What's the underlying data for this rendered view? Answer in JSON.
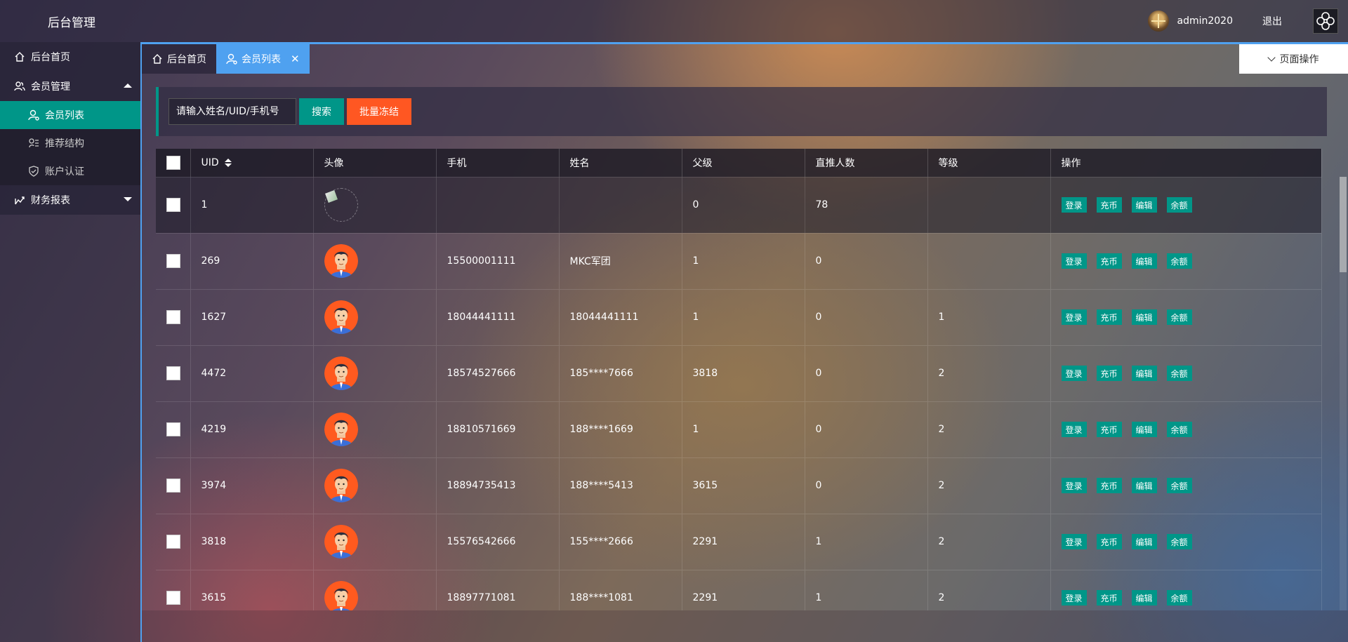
{
  "header": {
    "title": "后台管理",
    "user_name": "admin2020",
    "logout": "退出"
  },
  "sidebar": {
    "items": [
      {
        "label": "后台首页"
      },
      {
        "label": "会员管理"
      },
      {
        "label": "财务报表"
      }
    ],
    "sub_items": [
      {
        "label": "会员列表"
      },
      {
        "label": "推荐结构"
      },
      {
        "label": "账户认证"
      }
    ]
  },
  "tabs": [
    {
      "label": "后台首页"
    },
    {
      "label": "会员列表"
    }
  ],
  "page_ops": "页面操作",
  "search": {
    "placeholder": "请输入姓名/UID/手机号",
    "search_label": "搜索",
    "freeze_label": "批量冻结"
  },
  "table": {
    "columns": [
      "UID",
      "头像",
      "手机",
      "姓名",
      "父级",
      "直推人数",
      "等级",
      "操作"
    ],
    "op_labels": [
      "登录",
      "充币",
      "编辑",
      "余额"
    ],
    "rows": [
      {
        "uid": "1",
        "phone": "",
        "name": "",
        "parent": "0",
        "direct": "78",
        "level": ""
      },
      {
        "uid": "269",
        "phone": "15500001111",
        "name": "MKC军团",
        "parent": "1",
        "direct": "0",
        "level": ""
      },
      {
        "uid": "1627",
        "phone": "18044441111",
        "name": "18044441111",
        "parent": "1",
        "direct": "0",
        "level": "1"
      },
      {
        "uid": "4472",
        "phone": "18574527666",
        "name": "185****7666",
        "parent": "3818",
        "direct": "0",
        "level": "2"
      },
      {
        "uid": "4219",
        "phone": "18810571669",
        "name": "188****1669",
        "parent": "1",
        "direct": "0",
        "level": "2"
      },
      {
        "uid": "3974",
        "phone": "18894735413",
        "name": "188****5413",
        "parent": "3615",
        "direct": "0",
        "level": "2"
      },
      {
        "uid": "3818",
        "phone": "15576542666",
        "name": "155****2666",
        "parent": "2291",
        "direct": "1",
        "level": "2"
      },
      {
        "uid": "3615",
        "phone": "18897771081",
        "name": "188****1081",
        "parent": "2291",
        "direct": "1",
        "level": "2"
      }
    ]
  },
  "colors": {
    "accent": "#009688",
    "danger": "#ff5722",
    "tab_active": "#4fa1f0"
  }
}
